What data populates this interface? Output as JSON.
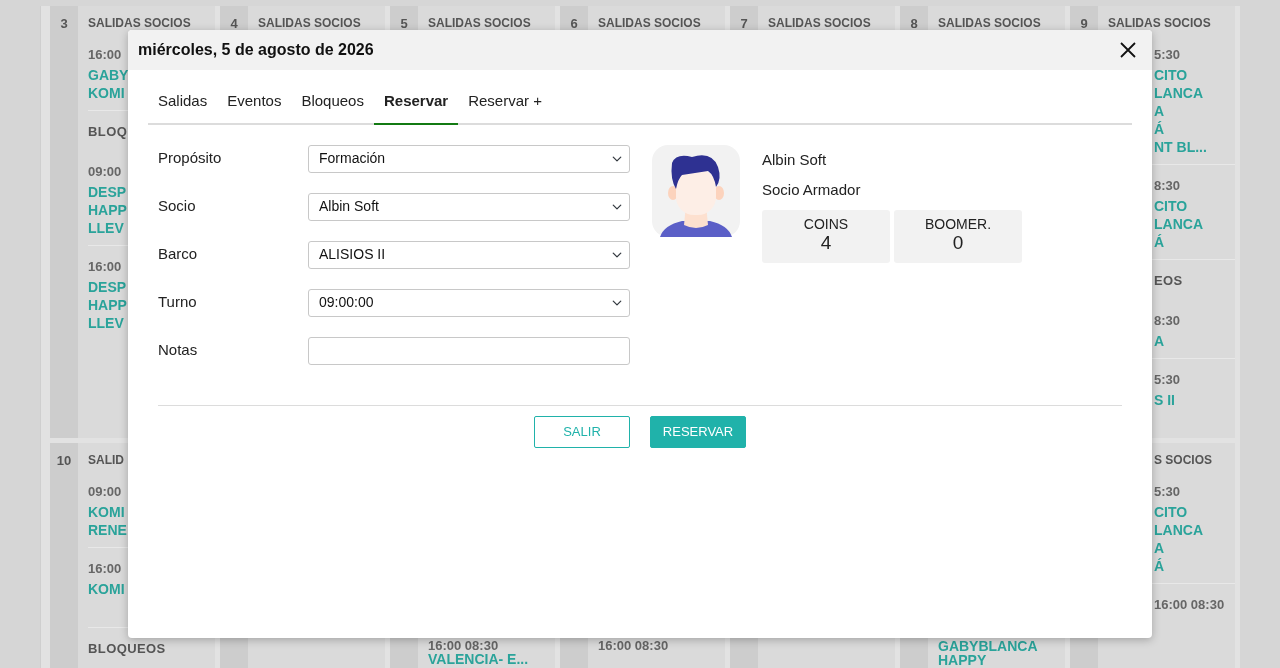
{
  "calendar": {
    "weeks": [
      {
        "days": [
          {
            "kind": "day",
            "number": "3",
            "header": "SALIDAS SOCIOS",
            "blocks": [
              {
                "kind": "slot",
                "time": "16:00",
                "lines": [
                  "GABY",
                  "KOMI"
                ]
              },
              {
                "kind": "section",
                "title": "BLOQ"
              },
              {
                "kind": "slot",
                "time": "09:00",
                "lines": [
                  "DESP",
                  "HAPP",
                  "LLEV"
                ]
              },
              {
                "kind": "slot",
                "time": "16:00",
                "lines": [
                  "DESP",
                  "HAPP",
                  "LLEV"
                ]
              }
            ]
          },
          {
            "kind": "day",
            "number": "4",
            "header": "SALIDAS SOCIOS"
          },
          {
            "kind": "day",
            "number": "5",
            "header": "SALIDAS SOCIOS"
          },
          {
            "kind": "day",
            "number": "6",
            "header": "SALIDAS SOCIOS"
          },
          {
            "kind": "day",
            "number": "7",
            "header": "SALIDAS SOCIOS"
          },
          {
            "kind": "day",
            "number": "8",
            "header": "SALIDAS SOCIOS"
          },
          {
            "kind": "day",
            "number": "9",
            "header": "SALIDAS SOCIOS",
            "blocks": [
              {
                "kind": "slot",
                "time": "5:30",
                "lines": [
                  "CITO",
                  "LANCA",
                  "A",
                  "Á",
                  "NT BL..."
                ]
              },
              {
                "kind": "slot",
                "time": "8:30",
                "lines": [
                  "CITO",
                  "LANCA",
                  "Á"
                ]
              },
              {
                "kind": "section",
                "title": "EOS"
              },
              {
                "kind": "slot",
                "time": "8:30",
                "lines": [
                  "A"
                ]
              },
              {
                "kind": "slot",
                "time": "5:30",
                "lines": [
                  "S II"
                ]
              }
            ]
          }
        ]
      },
      {
        "days": [
          {
            "kind": "day",
            "number": "10",
            "header": "SALID",
            "blocks": [
              {
                "kind": "slot",
                "time": "09:00",
                "lines": [
                  "KOMI",
                  "RENE"
                ]
              },
              {
                "kind": "slot",
                "time": "16:00",
                "lines": [
                  "KOMI"
                ]
              },
              {
                "kind": "section",
                "title": "BLOQUEOS"
              }
            ]
          },
          {
            "kind": "blank"
          },
          {
            "kind": "day",
            "blocks": [
              {
                "kind": "slot",
                "time": "16:00 08:30",
                "lines": [
                  "VALENCIA- E..."
                ]
              }
            ]
          },
          {
            "kind": "day",
            "blocks": [
              {
                "kind": "slot",
                "time": "16:00 08:30"
              }
            ]
          },
          {
            "kind": "blank"
          },
          {
            "kind": "day",
            "blocks": [
              {
                "kind": "slot",
                "lines": [
                  "GABYBLANCA",
                  "HAPPY"
                ]
              }
            ]
          },
          {
            "kind": "day",
            "header": "S SOCIOS",
            "blocks": [
              {
                "kind": "slot",
                "time": "5:30",
                "lines": [
                  "CITO",
                  "LANCA",
                  "A",
                  "Á"
                ]
              },
              {
                "kind": "slot",
                "time": "16:00 08:30"
              }
            ]
          }
        ]
      }
    ]
  },
  "dialog": {
    "title": "miércoles, 5 de agosto de 2026",
    "tabs": [
      {
        "label": "Salidas",
        "selected": false
      },
      {
        "label": "Eventos",
        "selected": false
      },
      {
        "label": "Bloqueos",
        "selected": false
      },
      {
        "label": "Reservar",
        "selected": true
      },
      {
        "label": "Reservar +",
        "selected": false
      }
    ],
    "fields": [
      {
        "label": "Propósito",
        "kind": "select",
        "value": "Formación"
      },
      {
        "label": "Socio",
        "kind": "select",
        "value": "Albin Soft"
      },
      {
        "label": "Barco",
        "kind": "select",
        "value": "ALISIOS II"
      },
      {
        "label": "Turno",
        "kind": "select",
        "value": "09:00:00"
      },
      {
        "label": "Notas",
        "kind": "text"
      }
    ],
    "member": {
      "name": "Albin Soft",
      "role": "Socio Armador",
      "stats": [
        {
          "label": "COINS",
          "value": "4"
        },
        {
          "label": "BOOMER.",
          "value": "0"
        }
      ]
    },
    "buttons": [
      {
        "label": "SALIR",
        "kind": "outline"
      },
      {
        "label": "RESERVAR",
        "kind": "primary"
      }
    ]
  }
}
